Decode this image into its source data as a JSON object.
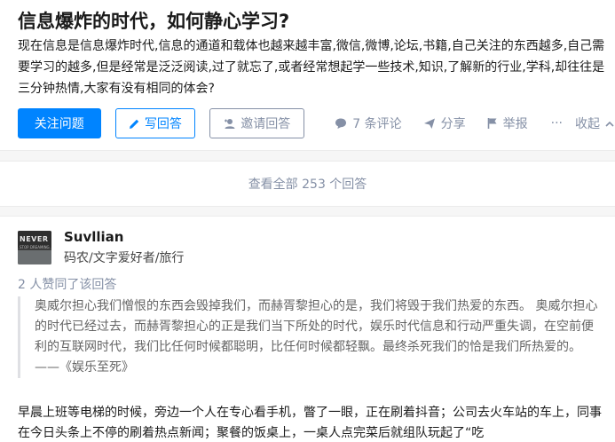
{
  "question": {
    "title": "信息爆炸的时代，如何静心学习?",
    "detail": "现在信息是信息爆炸时代,信息的通道和载体也越来越丰富,微信,微博,论坛,书籍,自己关注的东西越多,自己需要学习的越多,但是经常是泛泛阅读,过了就忘了,或者经常想起学一些技术,知识,了解新的行业,学科,却往往是三分钟热情,大家有没有相同的体会?",
    "actions": {
      "follow": "关注问题",
      "write": "写回答",
      "invite": "邀请回答",
      "comments": "7 条评论",
      "share": "分享",
      "report": "举报",
      "more": "···",
      "collapse": "收起"
    },
    "icons": {
      "write": "pencil-icon",
      "invite": "add-person-icon",
      "comments": "comment-bubble-icon",
      "share": "paper-plane-icon",
      "report": "flag-icon",
      "collapse": "chevron-up-icon"
    }
  },
  "view_all": "查看全部 253 个回答",
  "answer": {
    "author": {
      "name": "Suvllian",
      "bio": "码农/文字爱好者/旅行",
      "avatar_text": "NEVER",
      "avatar_subtext": "STOP DREAMING"
    },
    "upvotes": "2 人赞同了该回答",
    "quote": "奥威尔担心我们憎恨的东西会毁掉我们，而赫胥黎担心的是，我们将毁于我们热爱的东西。 奥威尔担心的时代已经过去，而赫胥黎担心的正是我们当下所处的时代，娱乐时代信息和行动严重失调，在空前便利的互联网时代，我们比任何时候都聪明，比任何时候都轻飘。最终杀死我们的恰是我们所热爱的。 ——《娱乐至死》",
    "body": "早晨上班等电梯的时候，旁边一个人在专心看手机，瞥了一眼，正在刷着抖音；公司去火车站的车上，同事在今日头条上不停的刷着热点新闻；聚餐的饭桌上，一桌人点完菜后就组队玩起了“吃"
  },
  "colors": {
    "primary": "#0084ff",
    "muted": "#8590a6",
    "background": "#f6f6f6",
    "text": "#1a1a1a"
  }
}
